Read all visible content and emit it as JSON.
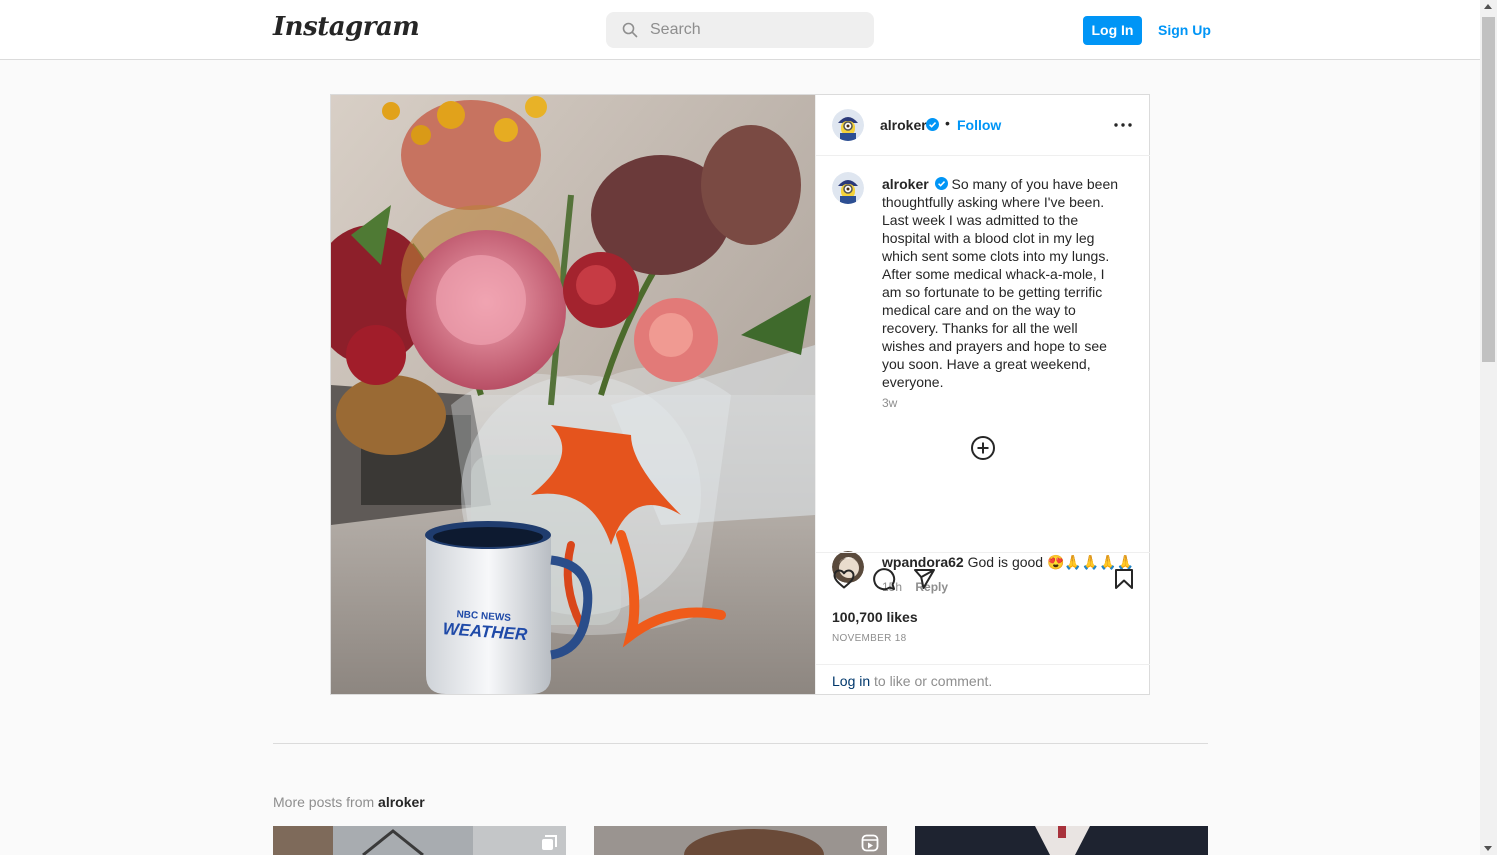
{
  "header": {
    "logo": "Instagram",
    "search_placeholder": "Search",
    "login_label": "Log In",
    "signup_label": "Sign Up"
  },
  "post": {
    "username": "alroker",
    "follow_label": "Follow",
    "separator": "•",
    "caption": "So many of you have been thoughtfully asking where I've been. Last week I was admitted to the hospital with a blood clot in my leg which sent some clots into my lungs. After some medical whack-a-mole, I am so fortunate to be getting terrific medical care and on the way to recovery. Thanks for all the well wishes and prayers and hope to see you soon. Have a great weekend, everyone.",
    "caption_time": "3w",
    "mug_brand": "NBC NEWS",
    "mug_label": "WEATHER",
    "comment": {
      "username": "wpandora62",
      "text": "God is good 😍🙏🙏🙏🙏",
      "time": "15h",
      "reply_label": "Reply"
    },
    "likes": "100,700 likes",
    "date": "NOVEMBER 18",
    "login_link": "Log in",
    "login_rest": "to like or comment."
  },
  "more_posts": {
    "prefix": "More posts from",
    "username": "alroker"
  },
  "colors": {
    "accent": "#0095f6",
    "verified": "#0095f6",
    "text": "#262626",
    "muted": "#8e8e8e",
    "border": "#dbdbdb",
    "background": "#fafafa"
  },
  "icons": [
    "search-icon",
    "verified-badge-icon",
    "more-options-icon",
    "add-comment-icon",
    "heart-icon",
    "comment-icon",
    "share-icon",
    "bookmark-icon",
    "carousel-icon",
    "reels-icon"
  ]
}
